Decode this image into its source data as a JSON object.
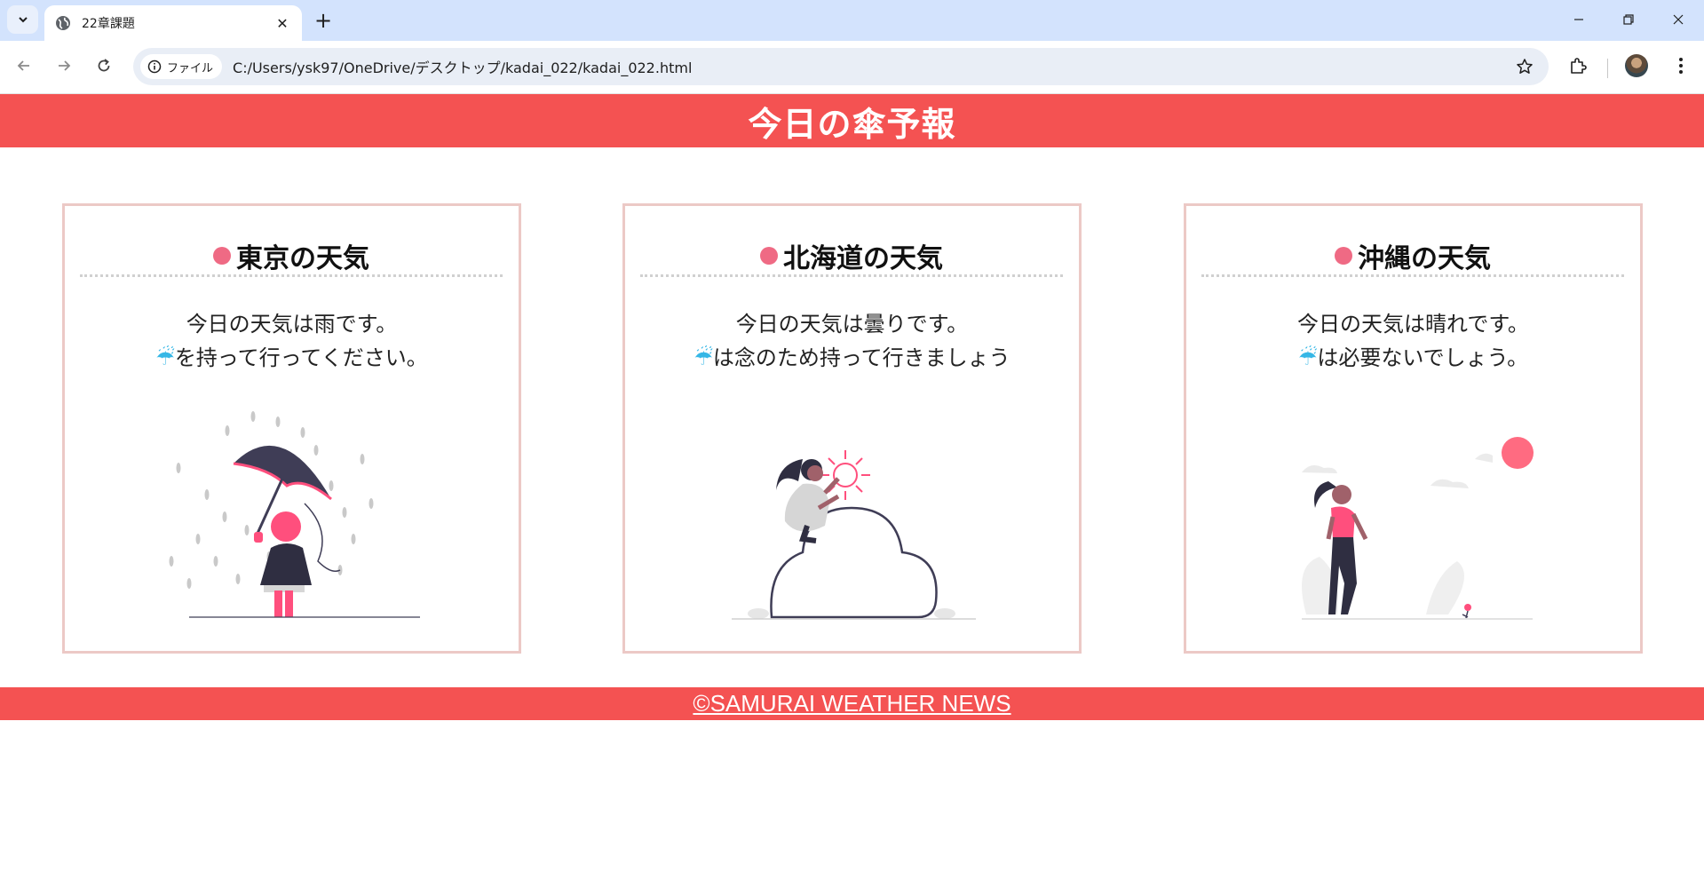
{
  "browser": {
    "tab_title": "22章課題",
    "chip_label": "ファイル",
    "url": "C:/Users/ysk97/OneDrive/デスクトップ/kadai_022/kadai_022.html",
    "accent": "#d3e3fd"
  },
  "page": {
    "title": "今日の傘予報",
    "brand_color": "#f45252",
    "card_border_color": "#ecc9c6",
    "bullet_color": "#ef6a84",
    "umbrella_icon_color": "#36b7e6",
    "umbrella_glyph": "☔",
    "cards": [
      {
        "title": "東京の天気",
        "line1": "今日の天気は雨です。",
        "line2": "を持って行ってください。",
        "illustration": "girl-with-umbrella-in-rain"
      },
      {
        "title": "北海道の天気",
        "line1": "今日の天気は曇りです。",
        "line2": "は念のため持って行きましょう",
        "illustration": "woman-on-cloud-with-sun"
      },
      {
        "title": "沖縄の天気",
        "line1": "今日の天気は晴れです。",
        "line2": "は必要ないでしょう。",
        "illustration": "woman-walking-sunny"
      }
    ],
    "footer": "©SAMURAI WEATHER NEWS"
  }
}
